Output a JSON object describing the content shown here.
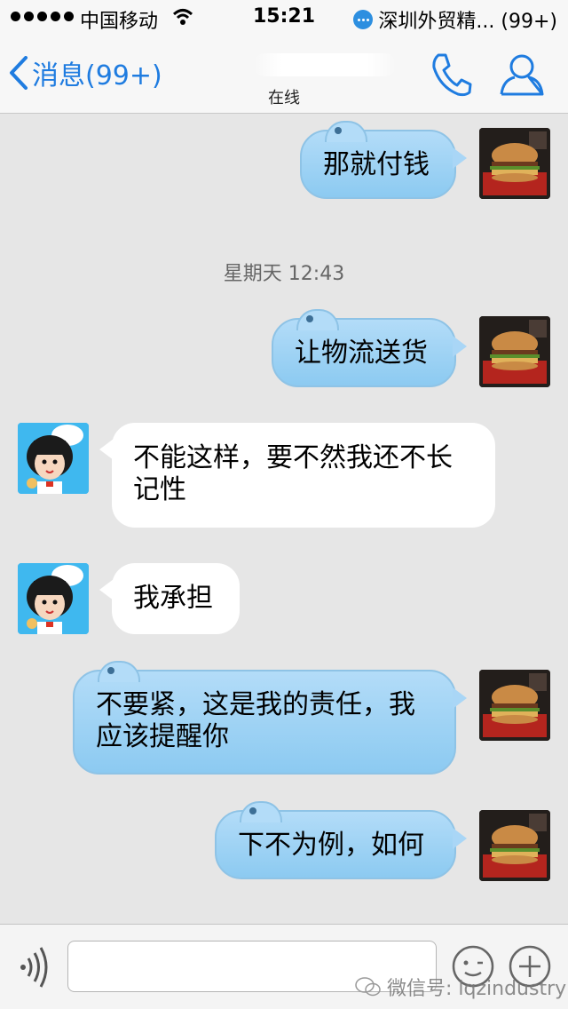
{
  "status_bar": {
    "carrier": "中国移动",
    "time": "15:21",
    "notification": "深圳外贸精... (99+)",
    "signal_icon": "signal-dots-icon",
    "wifi_icon": "wifi-icon",
    "notification_icon": "chat-bubble-icon"
  },
  "nav": {
    "back_label": "消息(99+)",
    "subtitle": "在线",
    "back_icon": "chevron-left-icon",
    "call_icon": "phone-icon",
    "profile_icon": "person-icon",
    "accent_color": "#1f7ce0"
  },
  "messages": [
    {
      "direction": "out",
      "text": "那就付钱"
    },
    {
      "type": "timestamp",
      "text": "星期天 12:43"
    },
    {
      "direction": "out",
      "text": "让物流送货"
    },
    {
      "direction": "in",
      "text": "不能这样，要不然我还不长记性"
    },
    {
      "direction": "in",
      "text": "我承担"
    },
    {
      "direction": "out",
      "text": "不要紧，这是我的责任，我应该提醒你"
    },
    {
      "direction": "out",
      "text": "下不为例，如何"
    }
  ],
  "input_bar": {
    "placeholder": "",
    "voice_icon": "voice-icon",
    "emoji_icon": "emoji-icon",
    "plus_icon": "plus-icon",
    "watermark": "微信号: lqzindustry"
  },
  "colors": {
    "outgoing_bubble": "#a9d6f6",
    "incoming_bubble": "#ffffff",
    "chat_background": "#e6e6e6"
  }
}
